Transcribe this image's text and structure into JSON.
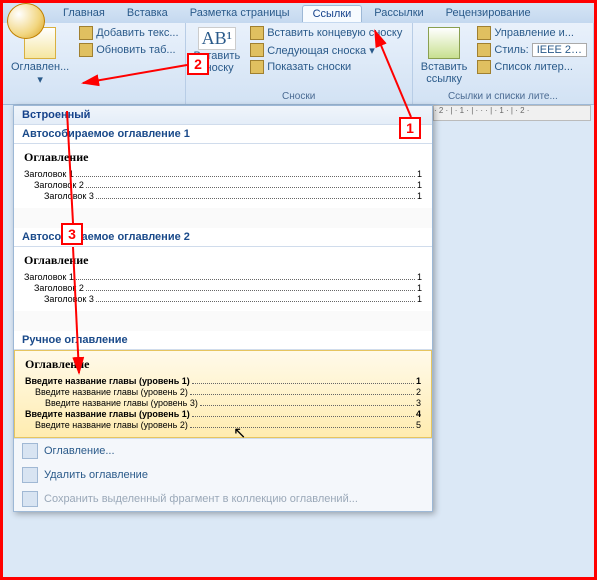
{
  "tabs": {
    "items": [
      "Главная",
      "Вставка",
      "Разметка страницы",
      "Ссылки",
      "Рассылки",
      "Рецензирование"
    ],
    "active_index": 3
  },
  "ribbon": {
    "toc_group": {
      "label": "Оглавлен...",
      "add_text": "Добавить текс...",
      "update_table": "Обновить таб..."
    },
    "footnote_group": {
      "insert_footnote": "Вставить\nсноску",
      "ab_label": "AB¹",
      "insert_endnote": "Вставить концевую сноску",
      "next_footnote": "Следующая сноска ▾",
      "show_footnotes": "Показать сноски",
      "group_label": "Сноски"
    },
    "ref_group": {
      "insert_ref": "Вставить\nссылку",
      "manage": "Управление и...",
      "style_label": "Стиль:",
      "style_value": "IEEE 2…",
      "bib": "Список литер...",
      "group_label": "Ссылки и списки лите..."
    }
  },
  "dropdown": {
    "builtin": "Встроенный",
    "auto1_title": "Автособираемое оглавление 1",
    "auto2_title": "Автособираемое оглавление 2",
    "manual_title": "Ручное оглавление",
    "toc_heading": "Оглавление",
    "h1": "Заголовок 1",
    "h2": "Заголовок 2",
    "h3": "Заголовок 3",
    "manual_l1a": "Введите название главы (уровень 1)",
    "manual_l2a": "Введите название главы (уровень 2)",
    "manual_l3": "Введите название главы (уровень 3)",
    "manual_l1b": "Введите название главы (уровень 1)",
    "manual_l2b": "Введите название главы (уровень 2)",
    "p1": "1",
    "p2": "2",
    "p3": "3",
    "p4": "4",
    "p5": "5",
    "footer_toc": "Оглавление...",
    "footer_remove": "Удалить оглавление",
    "footer_save": "Сохранить выделенный фрагмент в коллекцию оглавлений..."
  },
  "callouts": {
    "c1": "1",
    "c2": "2",
    "c3": "3"
  }
}
